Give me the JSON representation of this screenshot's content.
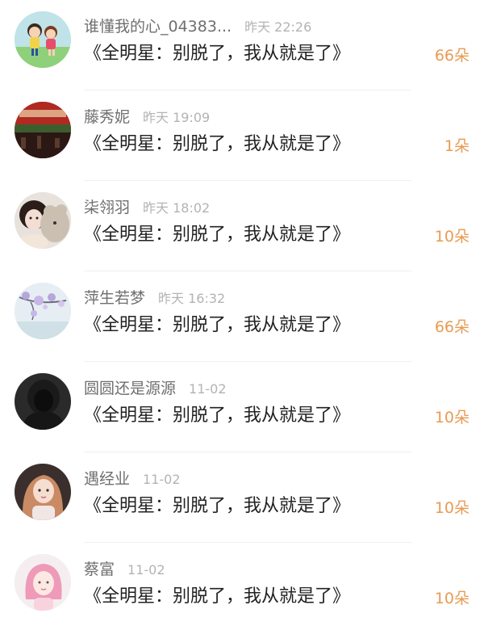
{
  "colors": {
    "name": "#6f6f6f",
    "time": "#b3b3b3",
    "text": "#222222",
    "amount": "#e89b53",
    "divider": "#f0f0f0"
  },
  "items": [
    {
      "name": "谁懂我的心_04383...",
      "time": "昨天 22:26",
      "text": "《全明星：别脱了，我从就是了》",
      "amount": "66朵",
      "avatar": "cartoon-kids-avatar"
    },
    {
      "name": "藤秀妮",
      "time": "昨天 19:09",
      "text": "《全明星：别脱了，我从就是了》",
      "amount": "1朵",
      "avatar": "red-banner-avatar"
    },
    {
      "name": "柒翎羽",
      "time": "昨天 18:02",
      "text": "《全明星：别脱了，我从就是了》",
      "amount": "10朵",
      "avatar": "girl-with-plush-avatar"
    },
    {
      "name": "萍生若梦",
      "time": "昨天 16:32",
      "text": "《全明星：别脱了，我从就是了》",
      "amount": "66朵",
      "avatar": "blossom-branch-avatar"
    },
    {
      "name": "圆圆还是源源",
      "time": "11-02",
      "text": "《全明星：别脱了，我从就是了》",
      "amount": "10朵",
      "avatar": "hooded-figure-avatar"
    },
    {
      "name": "遇经业",
      "time": "11-02",
      "text": "《全明星：别脱了，我从就是了》",
      "amount": "10朵",
      "avatar": "anime-girl-avatar"
    },
    {
      "name": "蔡富",
      "time": "11-02",
      "text": "《全明星：别脱了，我从就是了》",
      "amount": "10朵",
      "avatar": "pink-hair-girl-avatar"
    }
  ]
}
